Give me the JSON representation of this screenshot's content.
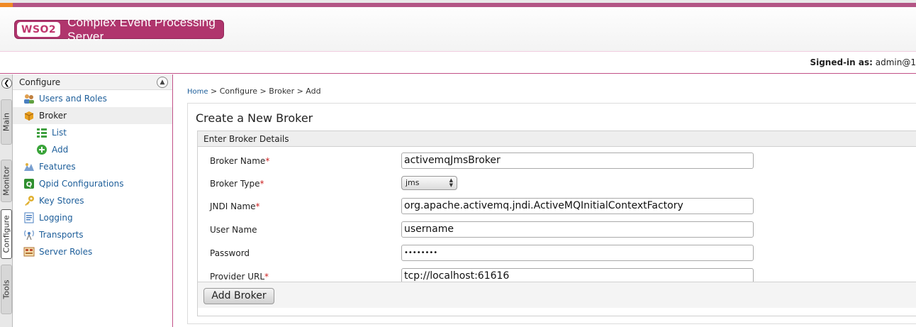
{
  "header": {
    "logo_text": "WSO2",
    "product_name": "Complex Event Processing Server",
    "signed_in_label": "Signed-in as:",
    "signed_in_user": "admin@1"
  },
  "left_tabs": [
    "Main",
    "Monitor",
    "Configure",
    "Tools"
  ],
  "active_left_tab": "Configure",
  "sidebar": {
    "title": "Configure",
    "items": [
      {
        "label": "Users and Roles",
        "icon": "users-roles-icon",
        "level": 1
      },
      {
        "label": "Broker",
        "icon": "broker-icon",
        "level": 1,
        "selected": true
      },
      {
        "label": "List",
        "icon": "list-icon",
        "level": 2
      },
      {
        "label": "Add",
        "icon": "add-icon",
        "level": 2
      },
      {
        "label": "Features",
        "icon": "features-icon",
        "level": 1
      },
      {
        "label": "Qpid Configurations",
        "icon": "qpid-icon",
        "level": 1
      },
      {
        "label": "Key Stores",
        "icon": "key-icon",
        "level": 1
      },
      {
        "label": "Logging",
        "icon": "logging-icon",
        "level": 1
      },
      {
        "label": "Transports",
        "icon": "transports-icon",
        "level": 1
      },
      {
        "label": "Server Roles",
        "icon": "server-roles-icon",
        "level": 1
      }
    ]
  },
  "breadcrumb": {
    "home": "Home",
    "path": "> Configure > Broker > Add"
  },
  "form": {
    "title": "Create a New Broker",
    "section_title": "Enter Broker Details",
    "required_mark": "*",
    "fields": {
      "broker_name": {
        "label": "Broker Name",
        "value": "activemqJmsBroker",
        "required": true
      },
      "broker_type": {
        "label": "Broker Type",
        "value": "jms",
        "required": true
      },
      "jndi_name": {
        "label": "JNDI Name",
        "value": "org.apache.activemq.jndi.ActiveMQInitialContextFactory",
        "required": true
      },
      "user_name": {
        "label": "User Name",
        "value": "username",
        "required": false
      },
      "password": {
        "label": "Password",
        "value": "••••••••",
        "required": false
      },
      "provider_url": {
        "label": "Provider URL",
        "value": "tcp://localhost:61616",
        "required": true
      }
    },
    "submit_label": "Add Broker"
  },
  "colors": {
    "brand": "#b0356d",
    "accent_orange": "#f08a24",
    "link": "#1d5e9a",
    "required": "#cc2222"
  }
}
